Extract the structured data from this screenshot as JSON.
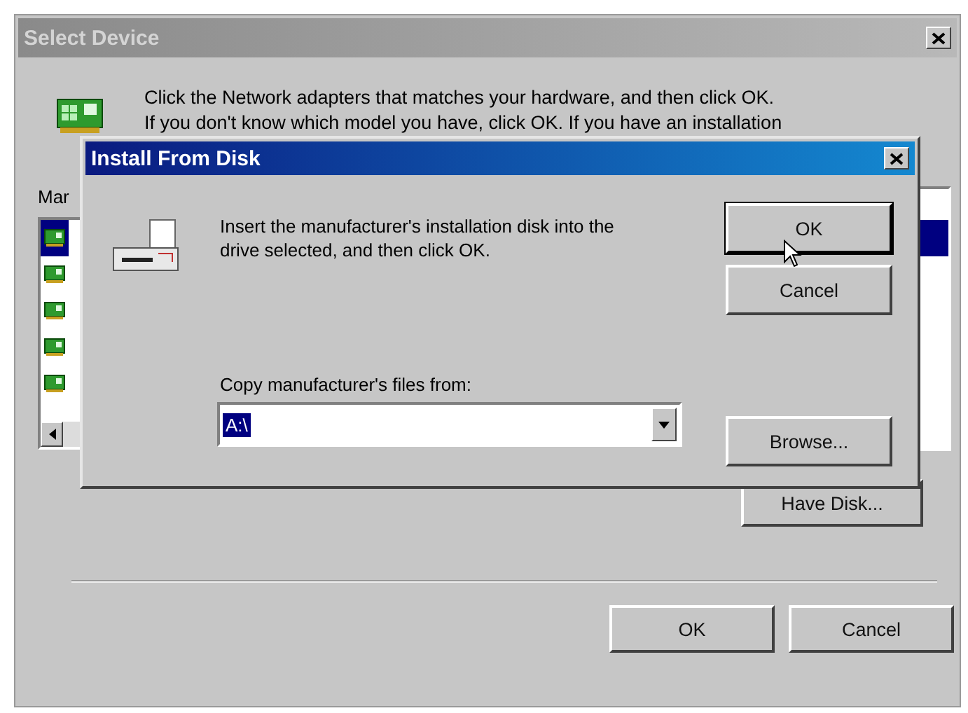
{
  "window": {
    "title": "Select Device",
    "active": false
  },
  "instructions": [
    "Click the Network adapters that matches your hardware, and then click OK.",
    "If you don't know which model you have, click OK. If you have an installation"
  ],
  "manufacturers": {
    "label": "Mar",
    "items": [
      {
        "selected": true
      },
      {
        "selected": false
      },
      {
        "selected": false
      },
      {
        "selected": false
      },
      {
        "selected": false
      }
    ]
  },
  "models": {
    "rows": [
      {
        "selected": true
      },
      {
        "selected": false
      },
      {
        "selected": false
      },
      {
        "selected": false
      },
      {
        "selected": false
      }
    ]
  },
  "have_disk_button": "Have Disk...",
  "buttons": [
    "OK",
    "Cancel"
  ],
  "install_dialog": {
    "title": "Install From Disk",
    "active": true,
    "message": "Insert the manufacturer's installation disk into the drive selected, and then click OK.",
    "buttons": [
      {
        "label": "OK",
        "default": true
      },
      {
        "label": "Cancel",
        "default": false
      }
    ],
    "source_label": "Copy manufacturer's files from:",
    "source_value": "A:\\",
    "browse_button": "Browse..."
  }
}
